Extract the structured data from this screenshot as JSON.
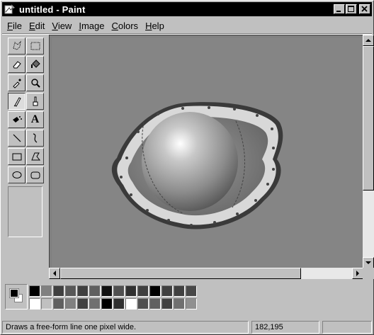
{
  "window": {
    "title": "untitled - Paint"
  },
  "menu": [
    {
      "label": "File",
      "accel": "F",
      "rest": "ile"
    },
    {
      "label": "Edit",
      "accel": "E",
      "rest": "dit"
    },
    {
      "label": "View",
      "accel": "V",
      "rest": "iew"
    },
    {
      "label": "Image",
      "accel": "I",
      "rest": "mage"
    },
    {
      "label": "Colors",
      "accel": "C",
      "rest": "olors"
    },
    {
      "label": "Help",
      "accel": "H",
      "rest": "elp"
    }
  ],
  "tools": [
    {
      "name": "free-form-select",
      "icon": "free-select-icon",
      "pressed": false
    },
    {
      "name": "select",
      "icon": "rect-select-icon",
      "pressed": false
    },
    {
      "name": "eraser",
      "icon": "eraser-icon",
      "pressed": false
    },
    {
      "name": "fill-with-color",
      "icon": "paint-bucket-icon",
      "pressed": false
    },
    {
      "name": "pick-color",
      "icon": "eyedropper-icon",
      "pressed": false
    },
    {
      "name": "magnifier",
      "icon": "magnifier-icon",
      "pressed": false
    },
    {
      "name": "pencil",
      "icon": "pencil-icon",
      "pressed": true
    },
    {
      "name": "brush",
      "icon": "brush-icon",
      "pressed": false
    },
    {
      "name": "airbrush",
      "icon": "airbrush-icon",
      "pressed": false
    },
    {
      "name": "text",
      "icon": "text-icon",
      "pressed": false
    },
    {
      "name": "line",
      "icon": "line-icon",
      "pressed": false
    },
    {
      "name": "curve",
      "icon": "curve-icon",
      "pressed": false
    },
    {
      "name": "rectangle",
      "icon": "rectangle-icon",
      "pressed": false
    },
    {
      "name": "polygon",
      "icon": "polygon-icon",
      "pressed": false
    },
    {
      "name": "ellipse",
      "icon": "ellipse-icon",
      "pressed": false
    },
    {
      "name": "rounded-rectangle",
      "icon": "rounded-rect-icon",
      "pressed": false
    }
  ],
  "text_tool_label": "A",
  "palette": {
    "foreground": "#000000",
    "background": "#ffffff",
    "top_row": [
      "#000000",
      "#808080",
      "#404040",
      "#585858",
      "#404040",
      "#606060",
      "#101010",
      "#505050",
      "#303030",
      "#404040",
      "#000000",
      "#404040",
      "#404040",
      "#484848"
    ],
    "bottom_row": [
      "#ffffff",
      "#c0c0c0",
      "#606060",
      "#808080",
      "#404040",
      "#707070",
      "#000000",
      "#303030",
      "#ffffff",
      "#505050",
      "#606060",
      "#404040",
      "#707070",
      "#909090"
    ]
  },
  "status": {
    "message": "Draws a free-form line one pixel wide.",
    "coords": "182,195"
  },
  "colors": {
    "canvas": "#858585",
    "workspace": "#808080",
    "title_bg": "#000000"
  }
}
